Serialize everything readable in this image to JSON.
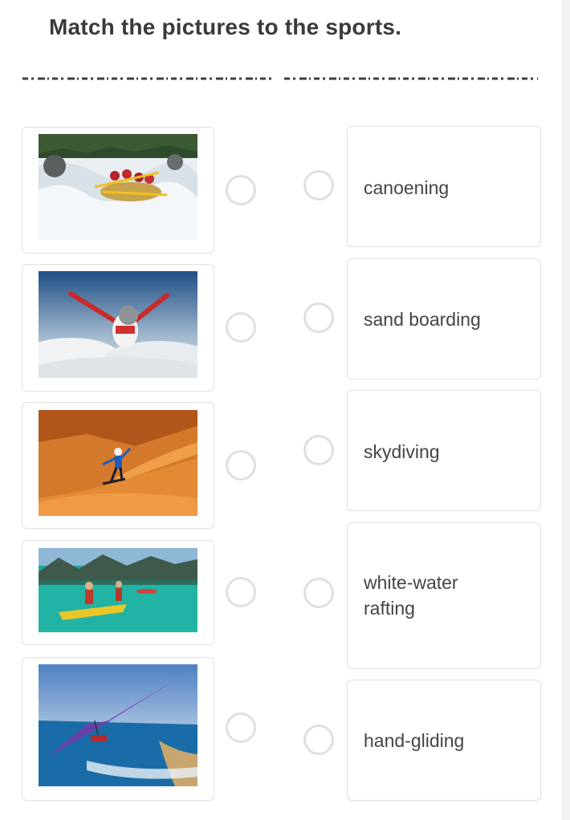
{
  "title": "Match the pictures to the sports.",
  "pictures": [
    {
      "icon": "white-water-rafting-photo"
    },
    {
      "icon": "skydiving-photo"
    },
    {
      "icon": "sand-boarding-photo"
    },
    {
      "icon": "canoeing-photo"
    },
    {
      "icon": "hang-gliding-photo"
    }
  ],
  "words": [
    {
      "label": "canoening"
    },
    {
      "label": "sand boarding"
    },
    {
      "label": "skydiving"
    },
    {
      "label": "white-water rafting"
    },
    {
      "label": "hand-gliding"
    }
  ],
  "colors": {
    "border": "#e0e0e0",
    "radio": "#dde0e3",
    "text": "#444444",
    "title": "#3a3a3a"
  }
}
